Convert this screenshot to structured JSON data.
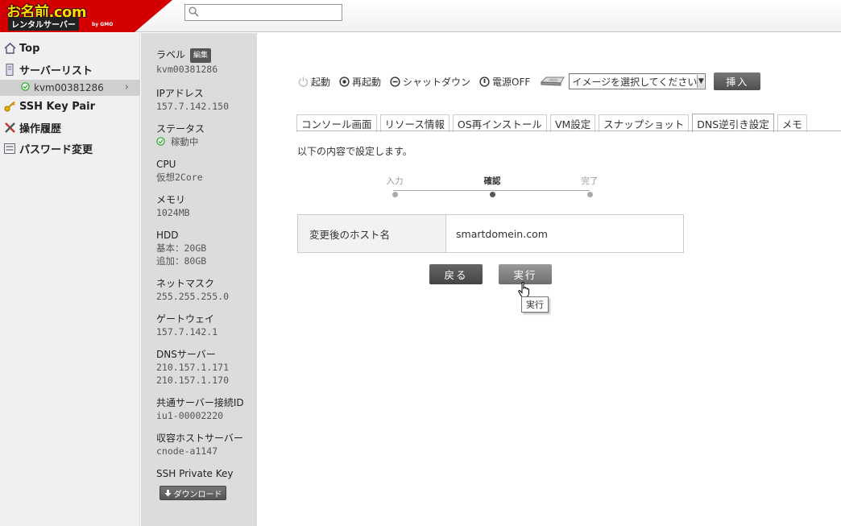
{
  "header": {
    "logo_main": "お名前.com",
    "logo_sub": "レンタルサーバー",
    "logo_gmo": "by GMO",
    "search_placeholder": ""
  },
  "nav": {
    "top": "Top",
    "server_list": "サーバーリスト",
    "server_item": "kvm00381286",
    "ssh_key": "SSH Key Pair",
    "history": "操作履歴",
    "password": "パスワード変更"
  },
  "info": {
    "label_key": "ラベル",
    "edit_badge": "編集",
    "label_val": "kvm00381286",
    "ip_key": "IPアドレス",
    "ip_val": "157.7.142.150",
    "status_key": "ステータス",
    "status_val": "稼動中",
    "cpu_key": "CPU",
    "cpu_val": "仮想2Core",
    "mem_key": "メモリ",
    "mem_val": "1024MB",
    "hdd_key": "HDD",
    "hdd_base": "基本：20GB",
    "hdd_add": "追加：80GB",
    "netmask_key": "ネットマスク",
    "netmask_val": "255.255.255.0",
    "gateway_key": "ゲートウェイ",
    "gateway_val": "157.7.142.1",
    "dns_key": "DNSサーバー",
    "dns_val1": "210.157.1.171",
    "dns_val2": "210.157.1.170",
    "shared_key": "共通サーバー接続ID",
    "shared_val": "iu1-00002220",
    "host_key": "収容ホストサーバー",
    "host_val": "cnode-a1147",
    "ssh_key": "SSH Private Key",
    "download": "ダウンロード"
  },
  "power": {
    "start": "起動",
    "restart": "再起動",
    "shutdown": "シャットダウン",
    "power_off": "電源OFF",
    "image_select": "イメージを選択してください",
    "insert": "挿入"
  },
  "tabs": [
    "コンソール画面",
    "リソース情報",
    "OS再インストール",
    "VM設定",
    "スナップショット",
    "DNS逆引き設定",
    "メモ"
  ],
  "active_tab": 5,
  "content": {
    "instructions": "以下の内容で設定します。",
    "steps": [
      "入力",
      "確認",
      "完了"
    ],
    "current_step": 1,
    "field_label": "変更後のホスト名",
    "field_value": "smartdomein.com",
    "back_button": "戻る",
    "exec_button": "実行",
    "tooltip": "実行"
  },
  "colors": {
    "brand_red": "#d40000",
    "brand_yellow": "#ffdd00",
    "status_green": "#44aa44"
  }
}
